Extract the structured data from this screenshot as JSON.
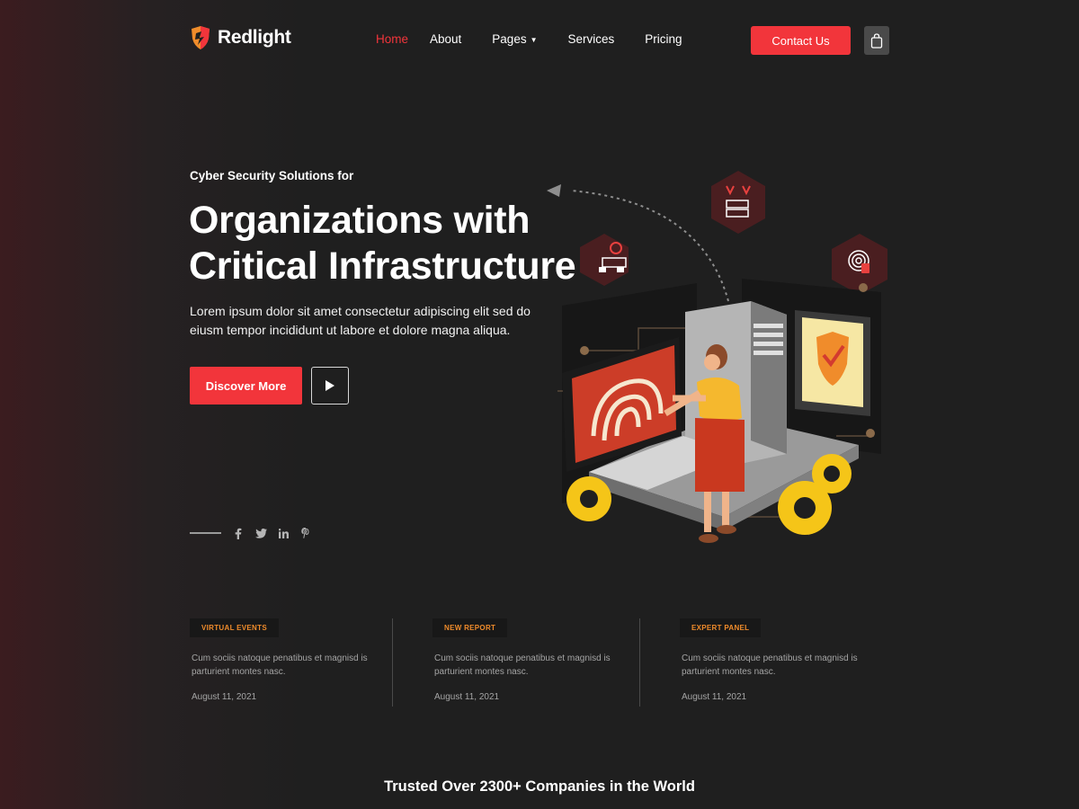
{
  "brand": {
    "name": "Redlight"
  },
  "nav": {
    "items": [
      {
        "label": "Home",
        "active": true
      },
      {
        "label": "About"
      },
      {
        "label": "Pages",
        "dropdown": true
      },
      {
        "label": "Services"
      },
      {
        "label": "Pricing"
      }
    ],
    "contact_label": "Contact Us"
  },
  "hero": {
    "eyebrow": "Cyber Security Solutions for",
    "title_line1": "Organizations with",
    "title_line2": "Critical Infrastructure",
    "description": "Lorem ipsum dolor sit amet consectetur adipiscing elit sed do eiusm tempor incididunt ut labore et dolore magna aliqua.",
    "cta_label": "Discover More"
  },
  "social": [
    "facebook-icon",
    "twitter-icon",
    "linkedin-icon",
    "pinterest-icon"
  ],
  "news": [
    {
      "tag": "VIRTUAL EVENTS",
      "text": "Cum sociis natoque penatibus et magnisd is parturient montes nasc.",
      "date": "August 11, 2021"
    },
    {
      "tag": "NEW REPORT",
      "text": "Cum sociis natoque penatibus et magnisd is parturient montes nasc.",
      "date": "August 11, 2021"
    },
    {
      "tag": "EXPERT PANEL",
      "text": "Cum sociis natoque penatibus et magnisd is parturient montes nasc.",
      "date": "August 11, 2021"
    }
  ],
  "trusted": "Trusted Over 2300+ Companies in the World",
  "colors": {
    "accent": "#f2353b",
    "tag_text": "#f08c2b",
    "background": "#1f1f1f"
  }
}
